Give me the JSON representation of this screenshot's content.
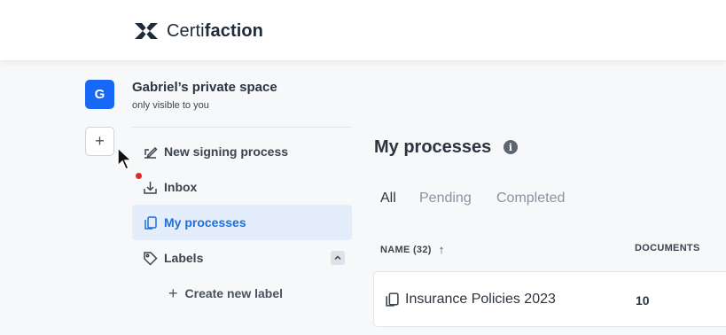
{
  "brand": {
    "name_light": "Certi",
    "name_bold": "faction",
    "color": "#1f2a3a"
  },
  "space": {
    "avatar_letter": "G",
    "avatar_color": "#1769f5",
    "name": "Gabriel’s private space",
    "subtitle": "only visible to you",
    "add_label": "+"
  },
  "nav": {
    "new_signing": "New signing process",
    "inbox": "Inbox",
    "inbox_has_notification": true,
    "my_processes": "My processes",
    "labels": "Labels",
    "create_label": "Create new label",
    "create_label_icon": "+"
  },
  "main": {
    "title": "My processes",
    "info_icon": "i",
    "tabs": [
      {
        "label": "All",
        "active": true
      },
      {
        "label": "Pending",
        "active": false
      },
      {
        "label": "Completed",
        "active": false
      }
    ],
    "columns": {
      "name": "NAME (32)",
      "sort_indicator": "↑",
      "documents": "DOCUMENTS"
    },
    "rows": [
      {
        "name": "Insurance Policies 2023",
        "documents": "10"
      }
    ]
  },
  "icons": {
    "logo": "certifaction-logo-icon",
    "signing": "signature-icon",
    "inbox": "download-tray-icon",
    "processes": "copy-documents-icon",
    "labels": "tag-icon",
    "collapse": "chevron-up-icon",
    "info": "info-icon"
  },
  "colors": {
    "accent": "#1f6fd6",
    "active_bg": "#e4eefb",
    "notification": "#e0262f"
  }
}
